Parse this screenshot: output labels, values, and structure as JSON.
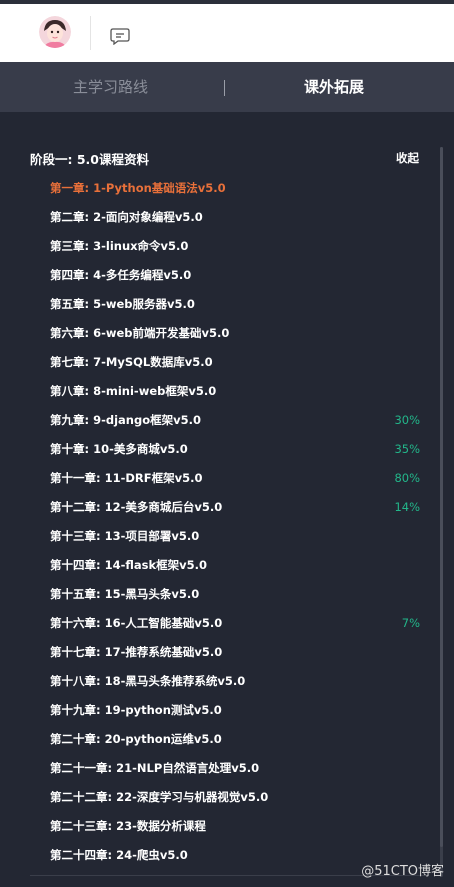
{
  "header": {
    "avatar": "user-avatar",
    "chat_icon": "chat-bubble-icon"
  },
  "tabs": [
    {
      "label": "主学习路线",
      "active": false
    },
    {
      "label": "课外拓展",
      "active": true
    }
  ],
  "stage": {
    "title": "阶段一: 5.0课程资料",
    "collapse_label": "收起"
  },
  "chapters": [
    {
      "label": "第一章: 1-Python基础语法v5.0",
      "progress": "",
      "active": true
    },
    {
      "label": "第二章: 2-面向对象编程v5.0",
      "progress": ""
    },
    {
      "label": "第三章: 3-linux命令v5.0",
      "progress": ""
    },
    {
      "label": "第四章: 4-多任务编程v5.0",
      "progress": ""
    },
    {
      "label": "第五章: 5-web服务器v5.0",
      "progress": ""
    },
    {
      "label": "第六章: 6-web前端开发基础v5.0",
      "progress": ""
    },
    {
      "label": "第七章: 7-MySQL数据库v5.0",
      "progress": ""
    },
    {
      "label": "第八章: 8-mini-web框架v5.0",
      "progress": ""
    },
    {
      "label": "第九章: 9-django框架v5.0",
      "progress": "30%"
    },
    {
      "label": "第十章: 10-美多商城v5.0",
      "progress": "35%"
    },
    {
      "label": "第十一章: 11-DRF框架v5.0",
      "progress": "80%"
    },
    {
      "label": "第十二章: 12-美多商城后台v5.0",
      "progress": "14%"
    },
    {
      "label": "第十三章: 13-项目部署v5.0",
      "progress": ""
    },
    {
      "label": "第十四章: 14-flask框架v5.0",
      "progress": ""
    },
    {
      "label": "第十五章: 15-黑马头条v5.0",
      "progress": ""
    },
    {
      "label": "第十六章: 16-人工智能基础v5.0",
      "progress": "7%"
    },
    {
      "label": "第十七章: 17-推荐系统基础v5.0",
      "progress": ""
    },
    {
      "label": "第十八章: 18-黑马头条推荐系统v5.0",
      "progress": ""
    },
    {
      "label": "第十九章: 19-python测试v5.0",
      "progress": ""
    },
    {
      "label": "第二十章: 20-python运维v5.0",
      "progress": ""
    },
    {
      "label": "第二十一章: 21-NLP自然语言处理v5.0",
      "progress": ""
    },
    {
      "label": "第二十二章: 22-深度学习与机器视觉v5.0",
      "progress": ""
    },
    {
      "label": "第二十三章: 23-数据分析课程",
      "progress": ""
    },
    {
      "label": "第二十四章: 24-爬虫v5.0",
      "progress": ""
    }
  ],
  "watermark": "@51CTO博客",
  "colors": {
    "active_chapter": "#e8703a",
    "progress": "#22b68a",
    "background": "#232733",
    "tab_bar": "#383c4a"
  }
}
